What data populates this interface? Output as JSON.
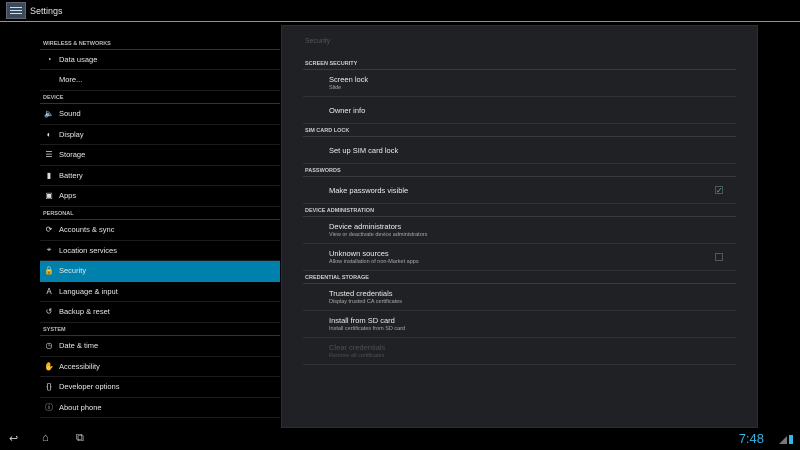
{
  "app": {
    "title": "Settings"
  },
  "sidebar": {
    "sections": [
      {
        "header": "WIRELESS & NETWORKS",
        "items": [
          {
            "label": "Data usage",
            "icon": "data-usage-icon"
          },
          {
            "label": "More..."
          }
        ]
      },
      {
        "header": "DEVICE",
        "items": [
          {
            "label": "Sound",
            "icon": "sound-icon"
          },
          {
            "label": "Display",
            "icon": "display-icon"
          },
          {
            "label": "Storage",
            "icon": "storage-icon"
          },
          {
            "label": "Battery",
            "icon": "battery-icon"
          },
          {
            "label": "Apps",
            "icon": "apps-icon"
          }
        ]
      },
      {
        "header": "PERSONAL",
        "items": [
          {
            "label": "Accounts & sync",
            "icon": "sync-icon"
          },
          {
            "label": "Location services",
            "icon": "location-icon"
          },
          {
            "label": "Security",
            "icon": "lock-icon",
            "selected": true
          },
          {
            "label": "Language & input",
            "icon": "language-icon"
          },
          {
            "label": "Backup & reset",
            "icon": "backup-icon"
          }
        ]
      },
      {
        "header": "SYSTEM",
        "items": [
          {
            "label": "Date & time",
            "icon": "clock-icon"
          },
          {
            "label": "Accessibility",
            "icon": "hand-icon"
          },
          {
            "label": "Developer options",
            "icon": "braces-icon"
          },
          {
            "label": "About phone",
            "icon": "info-icon"
          }
        ]
      }
    ]
  },
  "panel": {
    "title": "Security",
    "sections": [
      {
        "header": "SCREEN SECURITY",
        "items": [
          {
            "title": "Screen lock",
            "summary": "Slide"
          },
          {
            "title": "Owner info"
          }
        ]
      },
      {
        "header": "SIM CARD LOCK",
        "items": [
          {
            "title": "Set up SIM card lock"
          }
        ]
      },
      {
        "header": "PASSWORDS",
        "items": [
          {
            "title": "Make passwords visible",
            "checkbox": true,
            "checked": true
          }
        ]
      },
      {
        "header": "DEVICE ADMINISTRATION",
        "items": [
          {
            "title": "Device administrators",
            "summary": "View or deactivate device administrators"
          },
          {
            "title": "Unknown sources",
            "summary": "Allow installation of non-Market apps",
            "checkbox": true,
            "checked": false
          }
        ]
      },
      {
        "header": "CREDENTIAL STORAGE",
        "items": [
          {
            "title": "Trusted credentials",
            "summary": "Display trusted CA certificates"
          },
          {
            "title": "Install from SD card",
            "summary": "Install certificates from SD card"
          },
          {
            "title": "Clear credentials",
            "summary": "Remove all certificates",
            "disabled": true
          }
        ]
      }
    ]
  },
  "statusbar": {
    "time": "7:48"
  },
  "colors": {
    "accent": "#33b5e5",
    "selected": "#0080ac"
  }
}
